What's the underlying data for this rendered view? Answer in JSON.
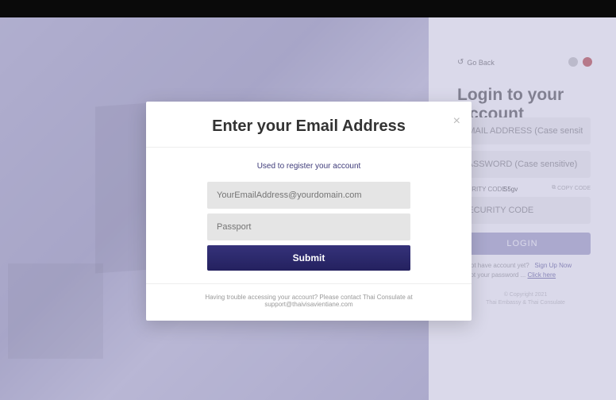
{
  "header": {
    "go_back": "Go Back"
  },
  "login": {
    "title": "Login to your Account",
    "email_placeholder": "EMAIL ADDRESS (Case sensitive)",
    "password_placeholder": "PASSWORD (Case sensitive)",
    "security_label": "SECURITY CODE :",
    "security_code": "S5gv",
    "copy_code": "COPY CODE",
    "security_placeholder": "SECURITY CODE",
    "button": "LOGIN",
    "no_account": "Do not have account yet?",
    "signup": "Sign Up Now",
    "forgot": "Forgot your password ...",
    "click_here": "Click here",
    "copyright1": "© Copyright 2021",
    "copyright2": "Thai Embassy & Thai Consulate"
  },
  "modal": {
    "title": "Enter your Email Address",
    "info": "Used to register your account",
    "email_placeholder": "YourEmailAddress@yourdomain.com",
    "passport_placeholder": "Passport",
    "submit": "Submit",
    "footer": "Having trouble accessing your account? Please contact Thai Consulate at support@thaivisavientiane.com"
  }
}
